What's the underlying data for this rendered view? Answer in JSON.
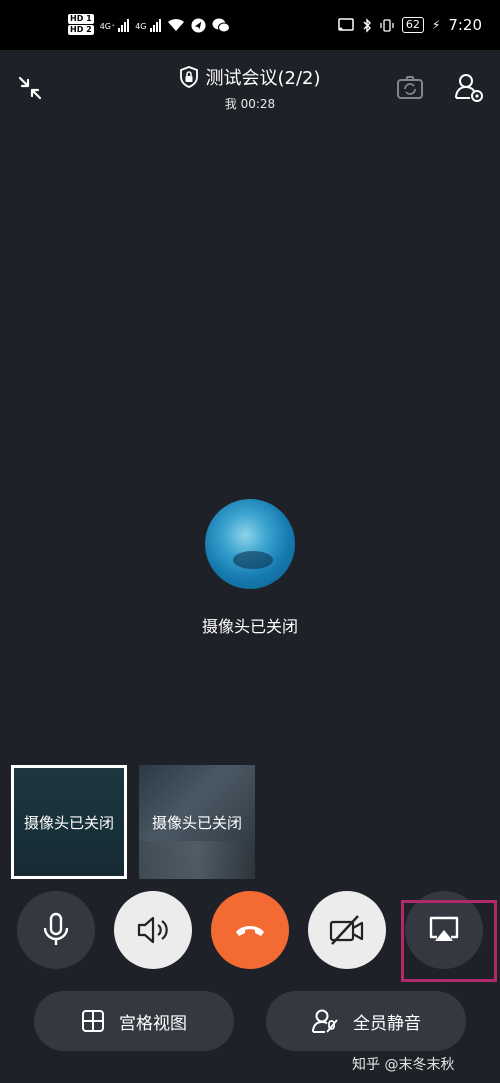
{
  "status_bar": {
    "hd1": "HD 1",
    "hd2": "HD 2",
    "net1": "4G⁺",
    "net2": "4G",
    "battery": "62",
    "time": "7:20"
  },
  "header": {
    "title": "测试会议(2/2)",
    "subtitle": "我 00:28"
  },
  "main_video": {
    "caption": "摄像头已关闭"
  },
  "thumbnails": [
    {
      "label": "摄像头已关闭"
    },
    {
      "label": "摄像头已关闭"
    }
  ],
  "controls": {
    "mic": "microphone-icon",
    "speaker": "speaker-icon",
    "hangup": "hangup-icon",
    "camera": "camera-off-icon",
    "share": "screen-share-icon"
  },
  "bottom_buttons": {
    "grid_view": "宫格视图",
    "mute_all": "全员静音"
  },
  "watermark": "知乎 @末冬末秋",
  "colors": {
    "background": "#1f2128",
    "hangup": "#f36b33",
    "button_dark": "#353841",
    "button_light": "#ececec",
    "highlight": "#b02a6a"
  }
}
